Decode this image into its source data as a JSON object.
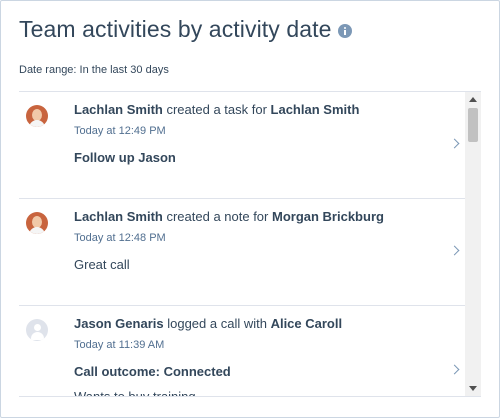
{
  "header": {
    "title": "Team activities by activity date",
    "info_icon": "info-icon"
  },
  "date_range": "Date range: In the last 30 days",
  "activities": [
    {
      "actor": "Lachlan Smith",
      "action": " created a task for ",
      "target": "Lachlan Smith",
      "time": "Today at 12:49 PM",
      "detail": "Follow up Jason",
      "subdetail": "",
      "avatar": "photo"
    },
    {
      "actor": "Lachlan Smith",
      "action": " created a note for ",
      "target": "Morgan Brickburg",
      "time": "Today at 12:48 PM",
      "detail": "Great call",
      "subdetail": "",
      "avatar": "photo"
    },
    {
      "actor": "Jason Genaris",
      "action": " logged a call with ",
      "target": "Alice Caroll",
      "time": "Today at 11:39 AM",
      "detail": "Call outcome: Connected",
      "subdetail": "Wants to buy training",
      "avatar": "placeholder"
    }
  ]
}
